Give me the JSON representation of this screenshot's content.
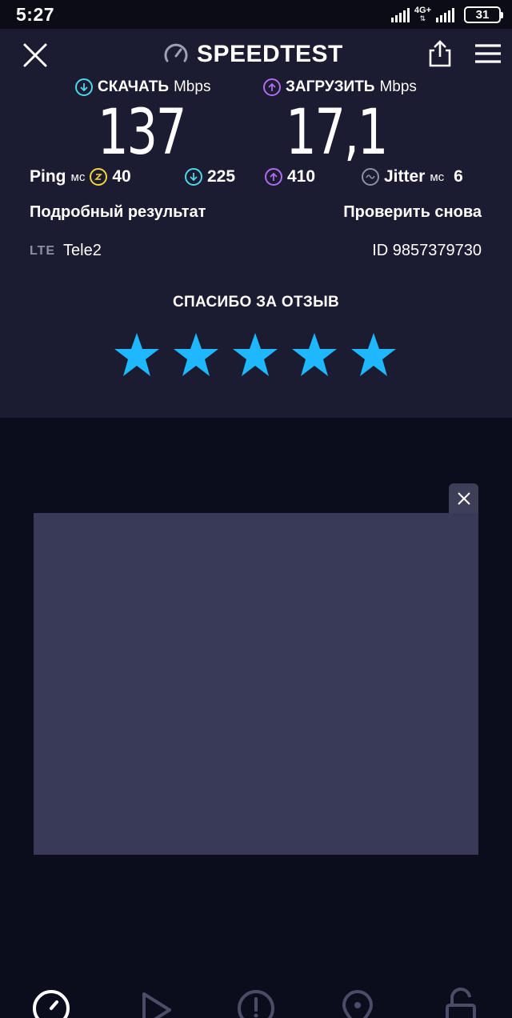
{
  "status": {
    "time": "5:27",
    "network": "4G+",
    "battery": "31"
  },
  "header": {
    "title": "SPEEDTEST"
  },
  "download": {
    "label": "СКАЧАТЬ",
    "unit": "Mbps",
    "value": "137",
    "color": "#4fd7e8"
  },
  "upload": {
    "label": "ЗАГРУЗИТЬ",
    "unit": "Mbps",
    "value": "17,1",
    "color": "#b06cf0"
  },
  "ping": {
    "label": "Ping",
    "unit": "мс",
    "idle": "40",
    "download": "225",
    "upload": "410",
    "idle_color": "#f2d43f"
  },
  "jitter": {
    "label": "Jitter",
    "unit": "мс",
    "value": "6"
  },
  "links": {
    "details": "Подробный результат",
    "retry": "Проверить снова"
  },
  "connection": {
    "type": "LTE",
    "carrier": "Tele2",
    "result_id": "ID 9857379730"
  },
  "feedback": {
    "title": "СПАСИБО ЗА ОТЗЫВ",
    "rating": 5,
    "max_rating": 5,
    "star_color": "#1fb8ff"
  },
  "nav": {
    "items": [
      "speed-icon",
      "play-icon",
      "alert-icon",
      "location-icon",
      "unlock-icon"
    ]
  }
}
